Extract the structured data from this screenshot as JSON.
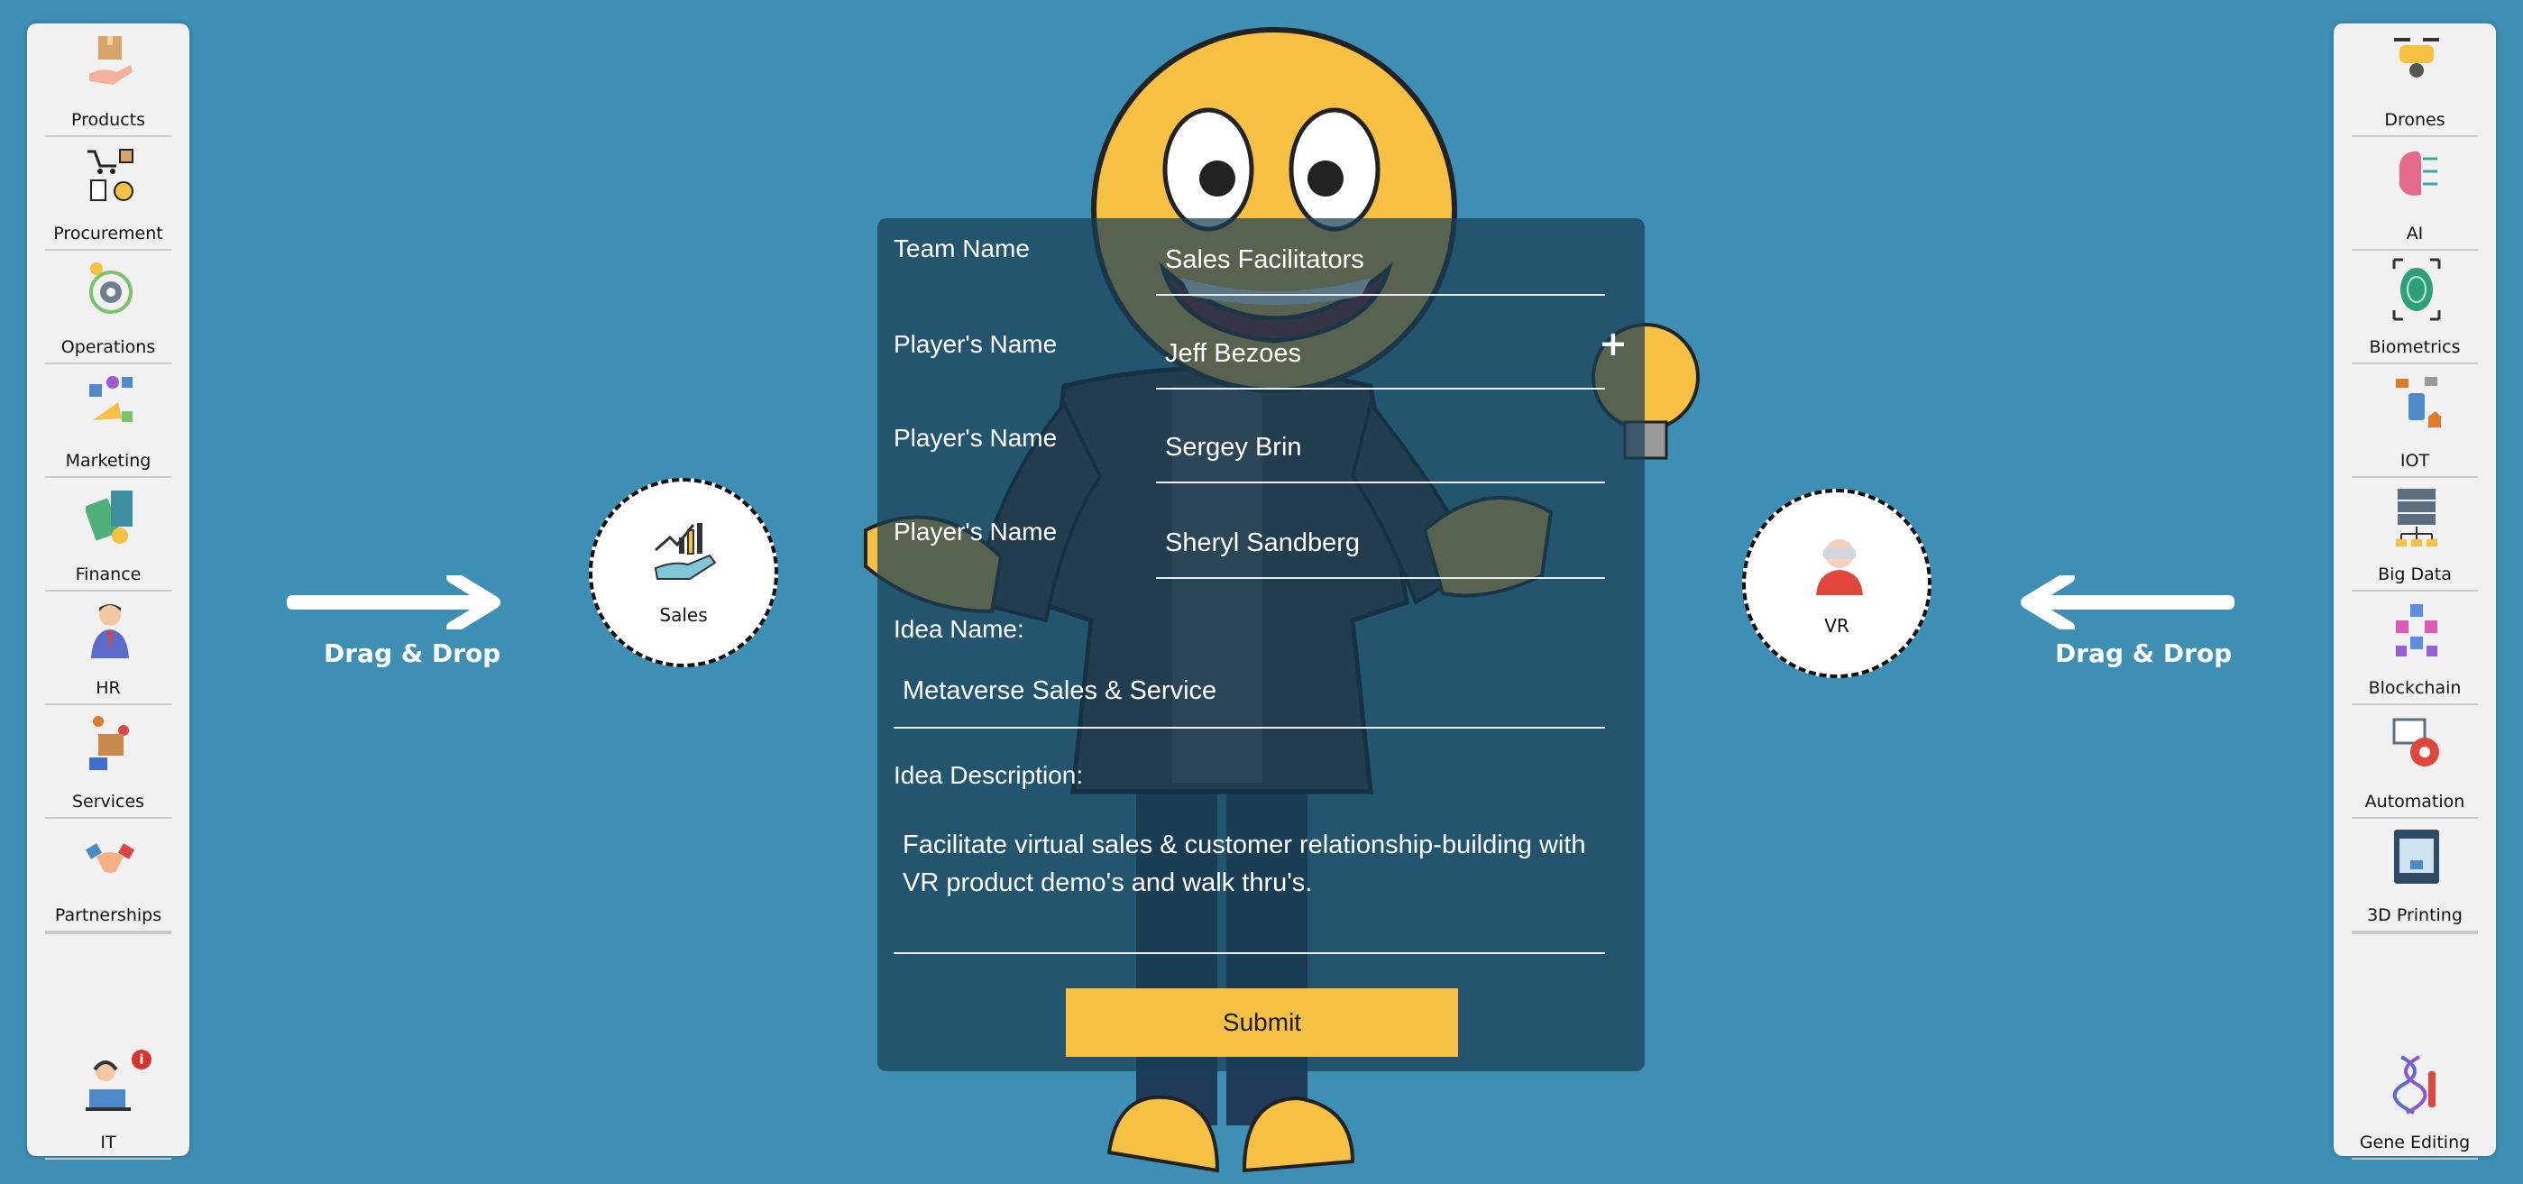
{
  "left_sidebar": {
    "items": [
      {
        "label": "Products",
        "icon": "products-box-hand-icon"
      },
      {
        "label": "Procurement",
        "icon": "procurement-cart-icon"
      },
      {
        "label": "Operations",
        "icon": "operations-gear-icon"
      },
      {
        "label": "Marketing",
        "icon": "marketing-megaphone-icon"
      },
      {
        "label": "Finance",
        "icon": "finance-money-icon"
      },
      {
        "label": "HR",
        "icon": "hr-person-icon"
      },
      {
        "label": "Services",
        "icon": "services-box-icon"
      },
      {
        "label": "Partnerships",
        "icon": "partnerships-handshake-icon"
      }
    ],
    "bottom": {
      "label": "IT",
      "icon": "it-support-icon",
      "badge": "i"
    }
  },
  "right_sidebar": {
    "items": [
      {
        "label": "Drones",
        "icon": "drone-icon"
      },
      {
        "label": "AI",
        "icon": "ai-brain-icon"
      },
      {
        "label": "Biometrics",
        "icon": "fingerprint-icon"
      },
      {
        "label": "IOT",
        "icon": "iot-devices-icon"
      },
      {
        "label": "Big Data",
        "icon": "big-data-server-icon"
      },
      {
        "label": "Blockchain",
        "icon": "blockchain-cubes-icon"
      },
      {
        "label": "Automation",
        "icon": "automation-gear-icon"
      },
      {
        "label": "3D Printing",
        "icon": "3d-printer-icon"
      }
    ],
    "bottom": {
      "label": "Gene Editing",
      "icon": "dna-icon"
    }
  },
  "drag_left": {
    "text": "Drag & Drop"
  },
  "drag_right": {
    "text": "Drag & Drop"
  },
  "drop_left": {
    "label": "Sales",
    "icon": "sales-chart-hand-icon"
  },
  "drop_right": {
    "label": "VR",
    "icon": "vr-headset-person-icon"
  },
  "form": {
    "team_label": "Team Name",
    "team_value": "Sales Facilitators",
    "player_label": "Player's Name",
    "players": [
      "Jeff Bezoes",
      "Sergey Brin",
      "Sheryl Sandberg"
    ],
    "idea_name_label": "Idea Name:",
    "idea_name_value": "Metaverse Sales & Service",
    "idea_desc_label": "Idea Description:",
    "idea_desc_value": "Facilitate virtual sales & customer relationship-building with VR product demo's and walk thru's.",
    "submit": "Submit",
    "add_symbol": "+"
  },
  "colors": {
    "background": "#3d8fb4",
    "submit": "#f6c142",
    "form_overlay": "#193e54"
  }
}
